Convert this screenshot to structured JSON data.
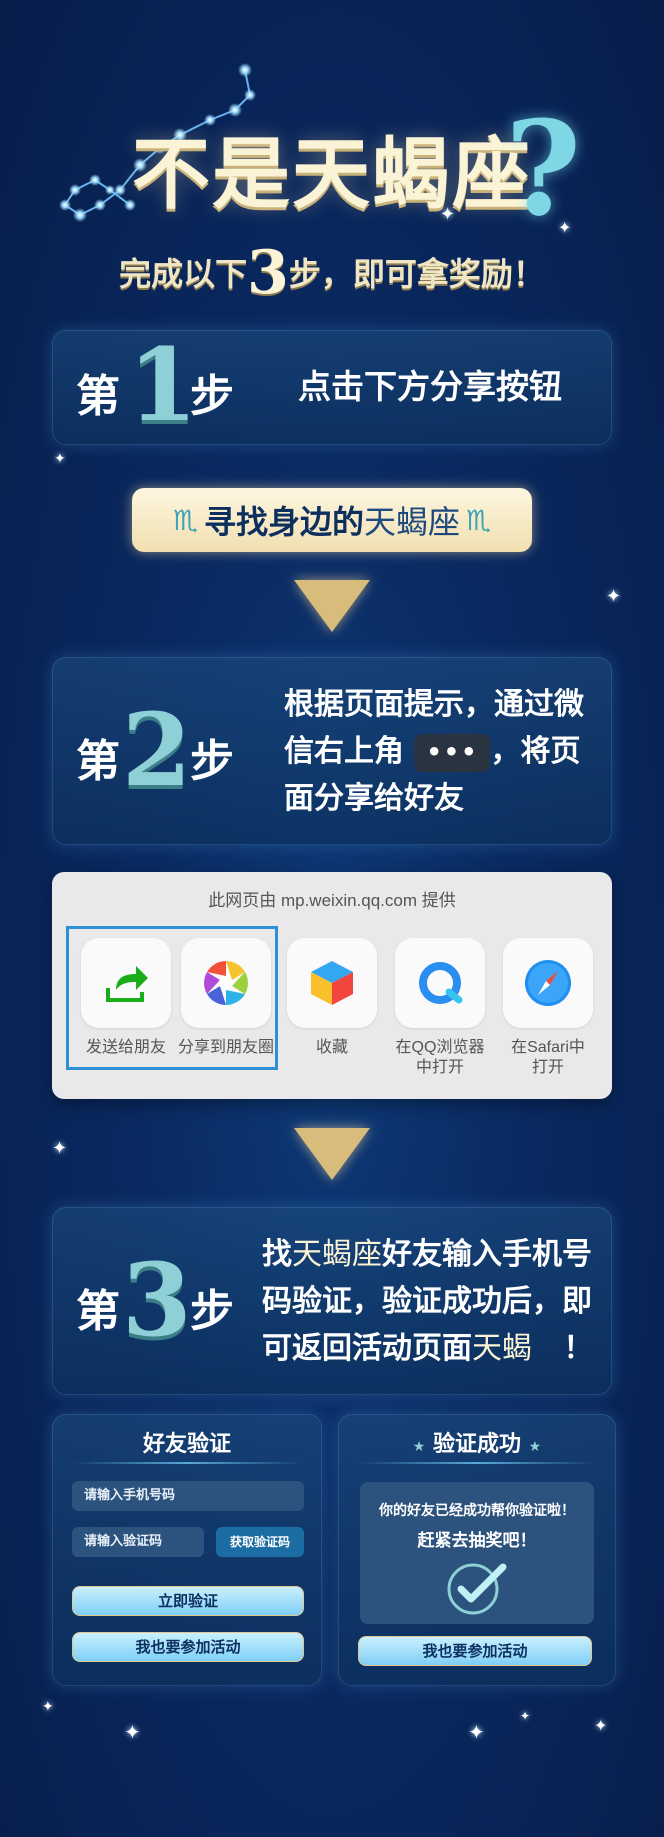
{
  "header": {
    "title": "不是天蝎座",
    "question_mark": "?",
    "subtitle_before": "完成以下",
    "subtitle_number": "3",
    "subtitle_after": "步，即可拿奖励！"
  },
  "steps": [
    {
      "label_before": "第",
      "number": "1",
      "label_after": "步",
      "text": "点击下方分享按钮"
    },
    {
      "label_before": "第",
      "number": "2",
      "label_after": "步",
      "line1": "根据页面提示，通过微",
      "line2_before": "信右上角",
      "menu_dots": "•••",
      "line2_after": "，将页",
      "line3": "面分享给好友"
    },
    {
      "label_before": "第",
      "number": "3",
      "label_after": "步",
      "line1_before": "找",
      "line1_zodiac": "天蝎座",
      "line1_after": "好友输入手机号",
      "line2": "码验证，验证成功后，即",
      "line3_before": "可返回活动页面",
      "line3_zodiac": "天蝎",
      "line3_after": "！"
    }
  ],
  "banner": {
    "before": "寻找身边的",
    "zodiac": "天蝎座",
    "glyph": "♏"
  },
  "share_sheet": {
    "title": "此网页由 mp.weixin.qq.com 提供",
    "items": [
      {
        "label": "发送给朋友",
        "icon": "share-forward-icon"
      },
      {
        "label": "分享到朋友圈",
        "icon": "moments-aperture-icon"
      },
      {
        "label": "收藏",
        "icon": "favorite-cube-icon"
      },
      {
        "label": "在QQ浏览器中打开",
        "label_line1": "在QQ浏览器",
        "label_line2": "中打开",
        "icon": "qq-browser-icon"
      },
      {
        "label": "在Safari中打开",
        "label_line1": "在Safari中",
        "label_line2": "打开",
        "icon": "safari-compass-icon"
      }
    ]
  },
  "verify_card": {
    "title": "好友验证",
    "phone_placeholder": "请输入手机号码",
    "code_placeholder": "请输入验证码",
    "get_code": "获取验证码",
    "verify_now": "立即验证",
    "join": "我也要参加活动"
  },
  "success_card": {
    "title": "验证成功",
    "message_line1": "你的好友已经成功帮你验证啦！",
    "message_line2": "赶紧去抽奖吧！",
    "join": "我也要参加活动"
  },
  "colors": {
    "background": "#0a2a62",
    "gold": "#d8bc7c",
    "cream": "#fbf3d6",
    "teal": "#8fd0d6",
    "highlight_border": "#2e91d6"
  }
}
